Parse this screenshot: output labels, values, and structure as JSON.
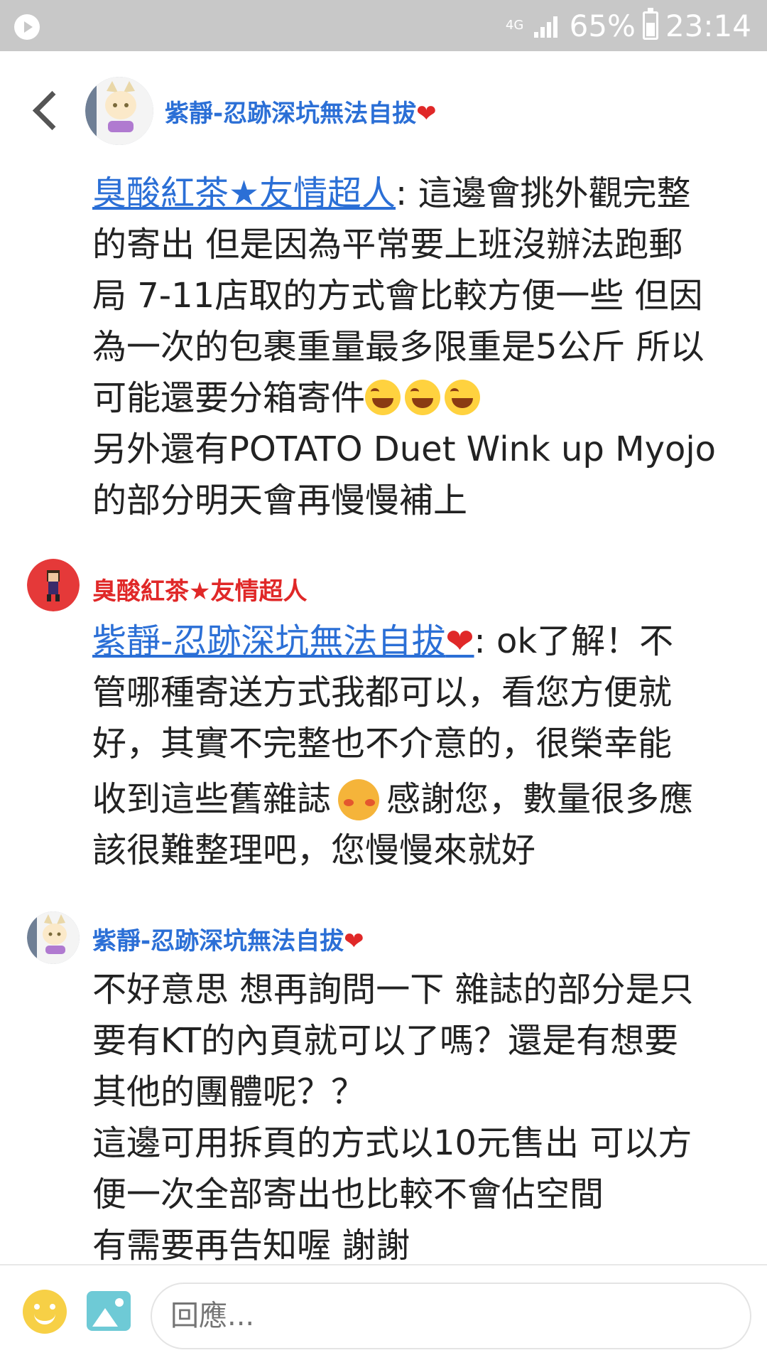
{
  "status_bar": {
    "network": "4G",
    "battery": "65%",
    "time": "23:14"
  },
  "header": {
    "author_name": "紫靜-忍跡深坑無法自拔",
    "heart": "❤"
  },
  "post": {
    "mention": "臭酸紅茶★友情超人",
    "text_lines": [
      ": 這邊會挑外觀完整",
      "的寄出 但是因為平常要上班沒辦法跑郵",
      "局 7-11店取的方式會比較方便一些 但因",
      "為一次的包裹重量最多限重是5公斤 所以",
      "可能還要分箱寄件"
    ],
    "line6": "另外還有POTATO Duet Wink up Myojo",
    "line7": "的部分明天會再慢慢補上"
  },
  "comment1": {
    "author": "臭酸紅茶★友情超人",
    "mention": "紫靜-忍跡深坑無法自拔",
    "heart": "❤",
    "line1_rest": ": ok了解！不",
    "line2": "管哪種寄送方式我都可以，看您方便就",
    "line3": "好，其實不完整也不介意的，很榮幸能",
    "line4a": "收到這些舊雜誌",
    "line4b": "感謝您，數量很多應",
    "line5": "該很難整理吧，您慢慢來就好"
  },
  "comment2": {
    "author": "紫靜-忍跡深坑無法自拔",
    "heart": "❤",
    "lines": [
      "不好意思 想再詢問一下 雜誌的部分是只",
      "要有KT的內頁就可以了嗎？還是有想要",
      "其他的團體呢？？",
      "這邊可用拆頁的方式以10元售出 可以方",
      "便一次全部寄出也比較不會佔空間",
      "有需要再告知喔 謝謝"
    ]
  },
  "composer": {
    "placeholder": "回應..."
  },
  "colors": {
    "link_blue": "#2b6fd6",
    "author_red": "#e02828",
    "status_gray": "#c8c8c8"
  }
}
